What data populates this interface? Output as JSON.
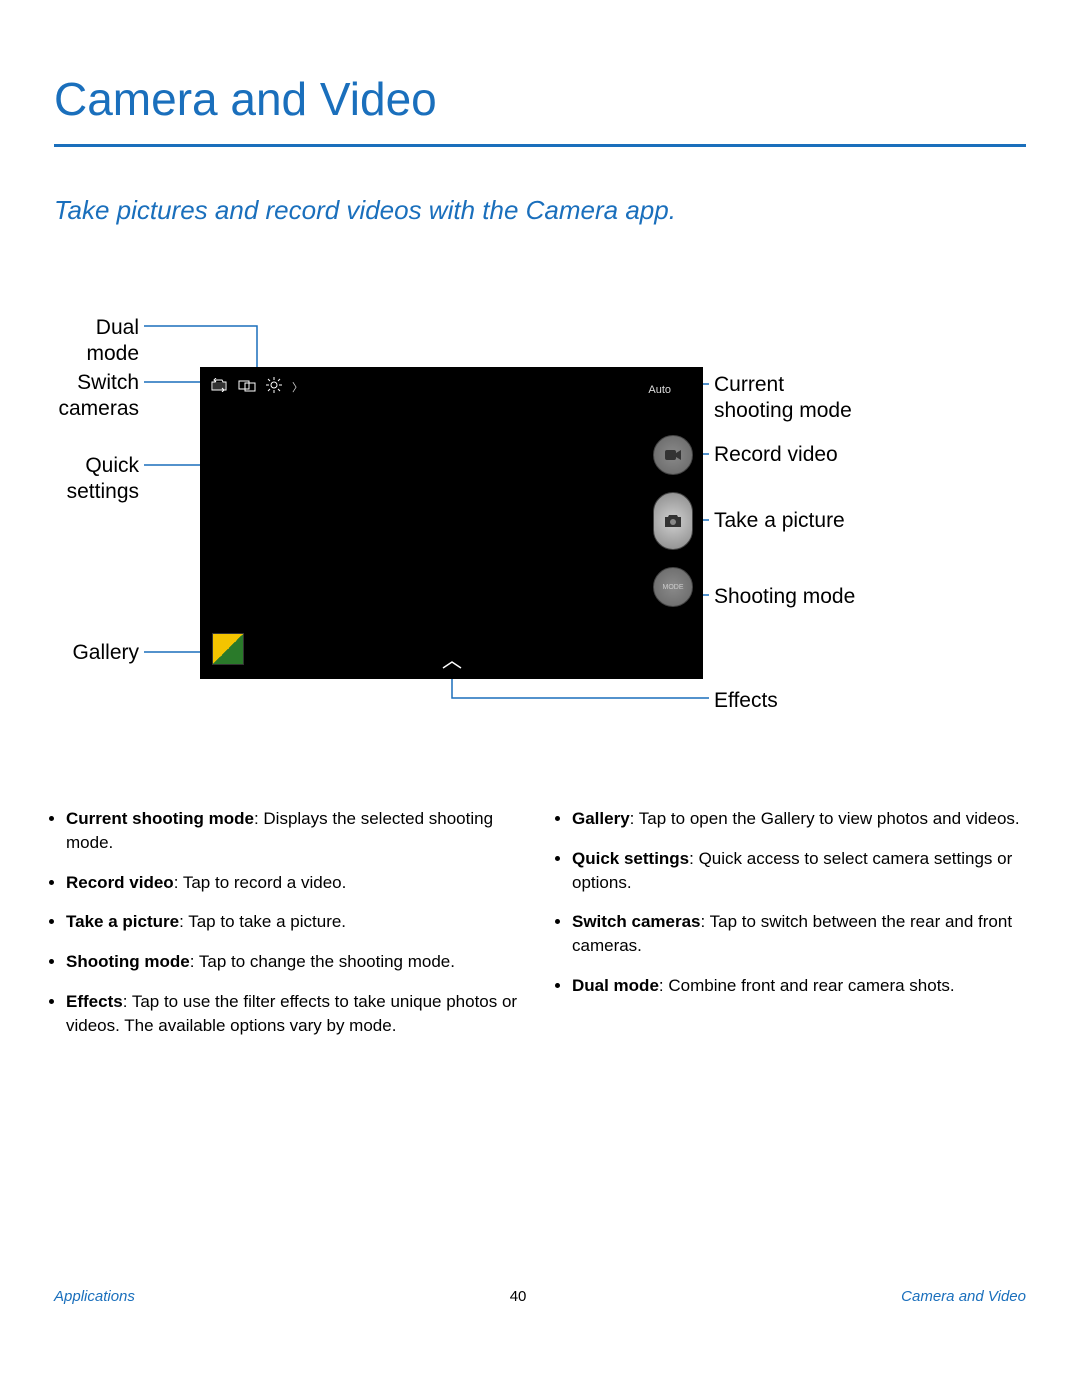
{
  "title": "Camera and Video",
  "subtitle": "Take pictures and record videos with the Camera app.",
  "labels": {
    "dual_mode": "Dual mode",
    "switch_cameras_l1": "Switch",
    "switch_cameras_l2": "cameras",
    "quick_settings_l1": "Quick",
    "quick_settings_l2": "settings",
    "gallery": "Gallery",
    "current_mode_l1": "Current",
    "current_mode_l2": "shooting mode",
    "record_video": "Record video",
    "take_picture": "Take a picture",
    "shooting_mode": "Shooting mode",
    "effects": "Effects"
  },
  "screen": {
    "auto_text": "Auto",
    "mode_text": "MODE"
  },
  "bullets_left": [
    {
      "term": "Current shooting mode",
      "desc": ": Displays the selected shooting mode."
    },
    {
      "term": "Record video",
      "desc": ": Tap to record a video."
    },
    {
      "term": "Take a picture",
      "desc": ": Tap to take a picture."
    },
    {
      "term": "Shooting mode",
      "desc": ": Tap to change the shooting mode."
    },
    {
      "term": "Effects",
      "desc": ": Tap to use the filter effects to take unique photos or videos. The available options vary by mode."
    }
  ],
  "bullets_right": [
    {
      "term": "Gallery",
      "desc": ": Tap to open the Gallery to view photos and videos."
    },
    {
      "term": "Quick settings",
      "desc": ": Quick access to select camera settings or options."
    },
    {
      "term": "Switch cameras",
      "desc": ": Tap to switch between the rear and front cameras."
    },
    {
      "term": "Dual mode",
      "desc": ": Combine front and rear camera shots."
    }
  ],
  "footer": {
    "left": "Applications",
    "page": "40",
    "right": "Camera and Video"
  }
}
